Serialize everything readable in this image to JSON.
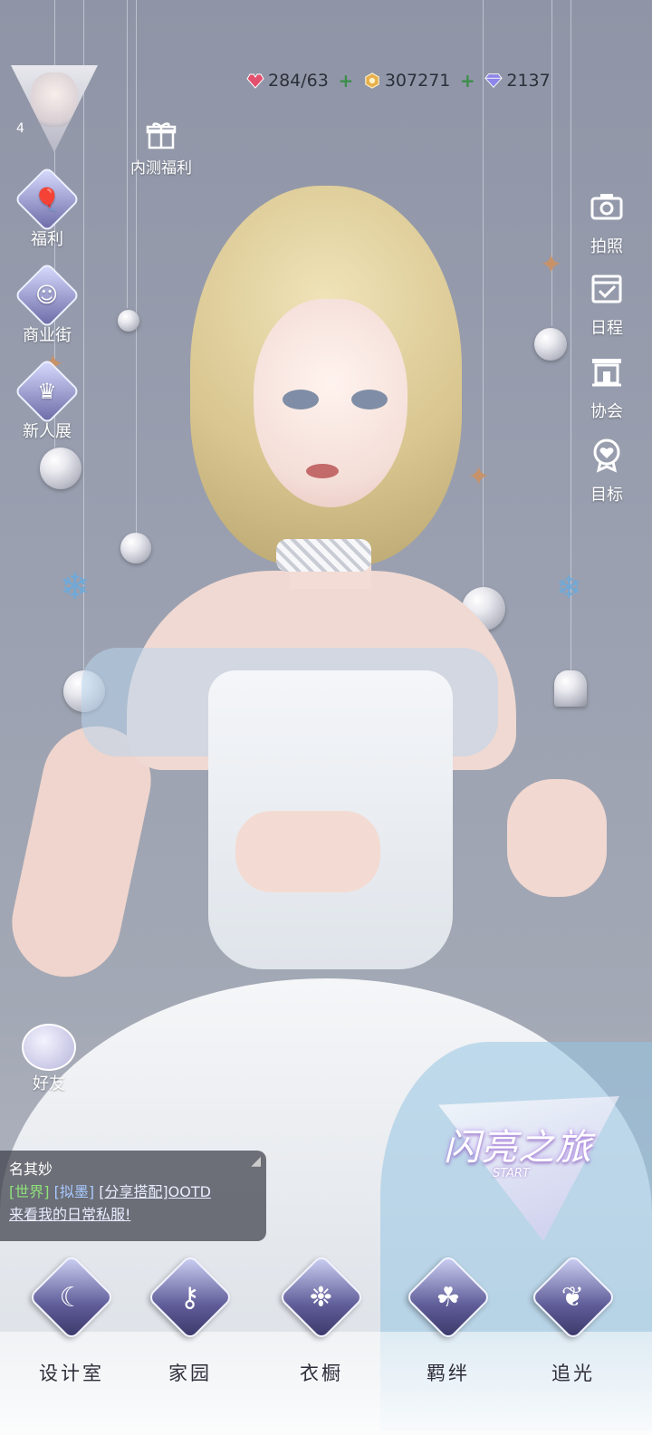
{
  "player": {
    "level": "4"
  },
  "currency": {
    "stamina": "284/63",
    "gold": "307271",
    "diamond": "2137"
  },
  "left_menu": [
    {
      "label": "福利",
      "icon": "balloon-icon"
    },
    {
      "label": "商业街",
      "icon": "shopping-bag-icon"
    },
    {
      "label": "新人展",
      "icon": "crown-icon"
    }
  ],
  "event": {
    "label": "内测福利",
    "icon": "gift-icon"
  },
  "right_menu": [
    {
      "label": "拍照",
      "icon": "camera-icon"
    },
    {
      "label": "日程",
      "icon": "calendar-check-icon"
    },
    {
      "label": "协会",
      "icon": "guild-hall-icon"
    },
    {
      "label": "目标",
      "icon": "heart-medal-icon"
    }
  ],
  "friends": {
    "label": "好友",
    "icon": "chat-bubbles-icon"
  },
  "chat": {
    "sender": "名其妙",
    "channel": "[世界]",
    "player": "[拟墨]",
    "message_link": "[分享搭配]OOTD",
    "message": "来看我的日常私服!"
  },
  "journey": {
    "title": "闪亮之旅",
    "subtitle": "START"
  },
  "bottom_nav": [
    {
      "label": "设计室",
      "icon": "moon-star-icon"
    },
    {
      "label": "家园",
      "icon": "key-icon"
    },
    {
      "label": "衣橱",
      "icon": "crystal-flower-icon"
    },
    {
      "label": "羁绊",
      "icon": "clover-icon"
    },
    {
      "label": "追光",
      "icon": "butterfly-icon"
    }
  ],
  "colors": {
    "accent": "#6c6aa6",
    "plus": "#3c8e4a",
    "chat_tag": "#8fe27a"
  }
}
